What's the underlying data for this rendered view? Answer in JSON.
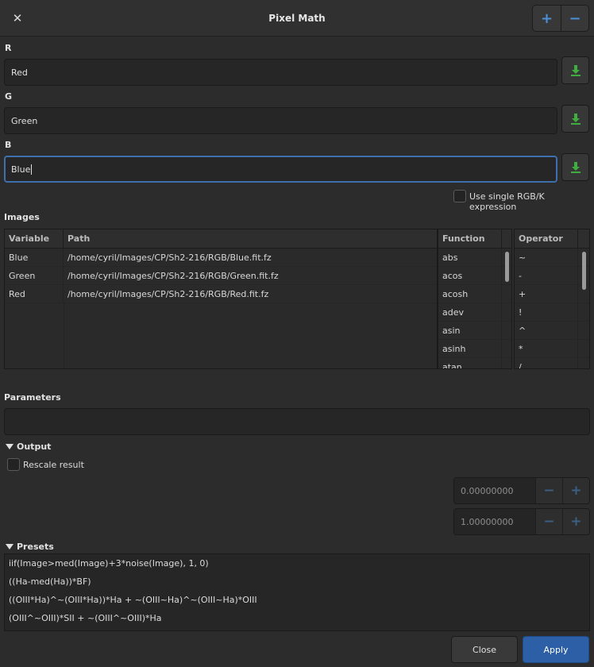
{
  "window": {
    "title": "Pixel Math",
    "close_glyph": "✕",
    "add_glyph": "+",
    "remove_glyph": "−"
  },
  "channels": [
    {
      "label": "R",
      "value": "Red"
    },
    {
      "label": "G",
      "value": "Green"
    },
    {
      "label": "B",
      "value": "Blue"
    }
  ],
  "single_rgb_label": "Use single RGB/K expression",
  "images": {
    "title": "Images",
    "headers": {
      "variable": "Variable",
      "path": "Path",
      "function": "Function",
      "operator": "Operator"
    },
    "rows": [
      {
        "variable": "Blue",
        "path": "/home/cyril/Images/CP/Sh2-216/RGB/Blue.fit.fz"
      },
      {
        "variable": "Green",
        "path": "/home/cyril/Images/CP/Sh2-216/RGB/Green.fit.fz"
      },
      {
        "variable": "Red",
        "path": "/home/cyril/Images/CP/Sh2-216/RGB/Red.fit.fz"
      }
    ],
    "functions": [
      "abs",
      "acos",
      "acosh",
      "adev",
      "asin",
      "asinh",
      "atan"
    ],
    "operators": [
      "~",
      "-",
      "+",
      "!",
      "^",
      "*",
      "/"
    ]
  },
  "parameters": {
    "title": "Parameters",
    "value": ""
  },
  "output": {
    "title": "Output",
    "rescale_label": "Rescale result",
    "min_value": "0.00000000",
    "max_value": "1.00000000",
    "minus_glyph": "−",
    "plus_glyph": "+"
  },
  "presets": {
    "title": "Presets",
    "items": [
      "iif(Image>med(Image)+3*noise(Image), 1, 0)",
      "((Ha-med(Ha))*BF)",
      "((OIII*Ha)^~(OIII*Ha))*Ha + ~(OIII~Ha)^~(OIII~Ha)*OIII",
      "(OIII^~OIII)*SII + ~(OIII^~OIII)*Ha"
    ]
  },
  "buttons": {
    "close": "Close",
    "apply": "Apply"
  },
  "icons": {
    "download": "download-icon",
    "accent": "#4a90d9",
    "apply_bg": "#2d5fa6",
    "download_color": "#3fae3f"
  }
}
